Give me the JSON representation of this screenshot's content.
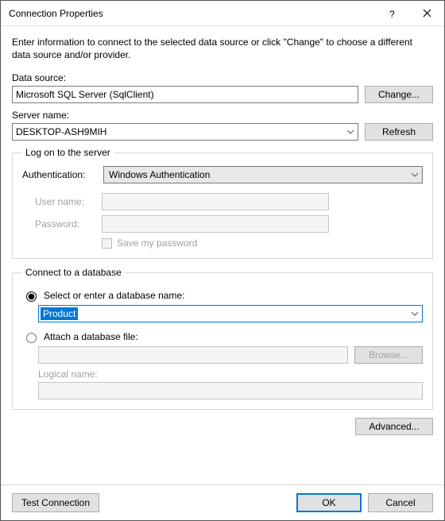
{
  "title": "Connection Properties",
  "intro": "Enter information to connect to the selected data source or click \"Change\" to choose a different data source and/or provider.",
  "dataSource": {
    "label": "Data source:",
    "value": "Microsoft SQL Server (SqlClient)",
    "changeBtn": "Change..."
  },
  "serverName": {
    "label": "Server name:",
    "value": "DESKTOP-ASH9MIH",
    "refreshBtn": "Refresh"
  },
  "logon": {
    "legend": "Log on to the server",
    "authLabel": "Authentication:",
    "authValue": "Windows Authentication",
    "userLabel": "User name:",
    "passLabel": "Password:",
    "savePwd": "Save my password"
  },
  "database": {
    "legend": "Connect to a database",
    "selectRadio": "Select or enter a database name:",
    "selectedDb": "Product",
    "attachRadio": "Attach a database file:",
    "browseBtn": "Browse...",
    "logicalLabel": "Logical name:"
  },
  "advancedBtn": "Advanced...",
  "footer": {
    "test": "Test Connection",
    "ok": "OK",
    "cancel": "Cancel"
  }
}
